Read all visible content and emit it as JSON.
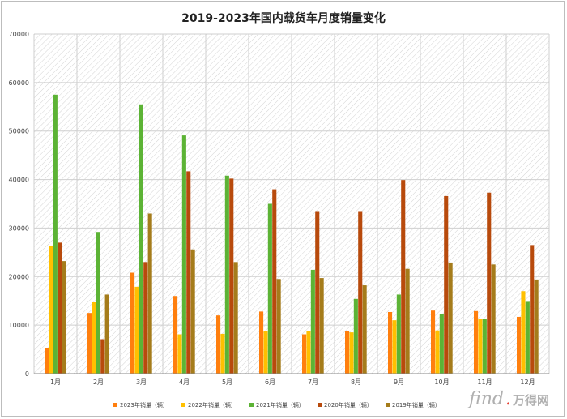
{
  "chart_data": {
    "type": "bar",
    "title": "2019-2023年国内载货车月度销量变化",
    "categories": [
      "1月",
      "2月",
      "3月",
      "4月",
      "5月",
      "6月",
      "7月",
      "8月",
      "9月",
      "10月",
      "11月",
      "12月"
    ],
    "ylim": [
      0,
      70000
    ],
    "yticks": [
      0,
      10000,
      20000,
      30000,
      40000,
      50000,
      60000,
      70000
    ],
    "legend_position": "bottom",
    "grid": true,
    "series": [
      {
        "name": "2023年销量（辆）",
        "color": "#ff7f0e",
        "values": [
          5200,
          12500,
          20800,
          16000,
          12000,
          12800,
          8100,
          8800,
          12700,
          13000,
          12900,
          11700
        ]
      },
      {
        "name": "2022年销量（辆）",
        "color": "#ffc000",
        "values": [
          26400,
          14700,
          17900,
          8100,
          8200,
          8800,
          8700,
          8500,
          11000,
          8900,
          11300,
          17000
        ]
      },
      {
        "name": "2021年销量（辆）",
        "color": "#5cb335",
        "values": [
          57500,
          29200,
          55500,
          49100,
          40800,
          35000,
          21400,
          15400,
          16300,
          12200,
          11200,
          14800
        ]
      },
      {
        "name": "2020年销量（辆）",
        "color": "#b84a0c",
        "values": [
          27000,
          7100,
          23000,
          41700,
          40200,
          38000,
          33500,
          33500,
          39900,
          36600,
          37300,
          26500
        ]
      },
      {
        "name": "2019年销量（辆）",
        "color": "#a57c1b",
        "values": [
          23200,
          16300,
          33000,
          25600,
          23000,
          19500,
          19700,
          18200,
          21600,
          22900,
          22500,
          19400
        ]
      }
    ]
  },
  "watermark": {
    "brand": "find",
    "dot": ".",
    "suffix": "万得网"
  }
}
